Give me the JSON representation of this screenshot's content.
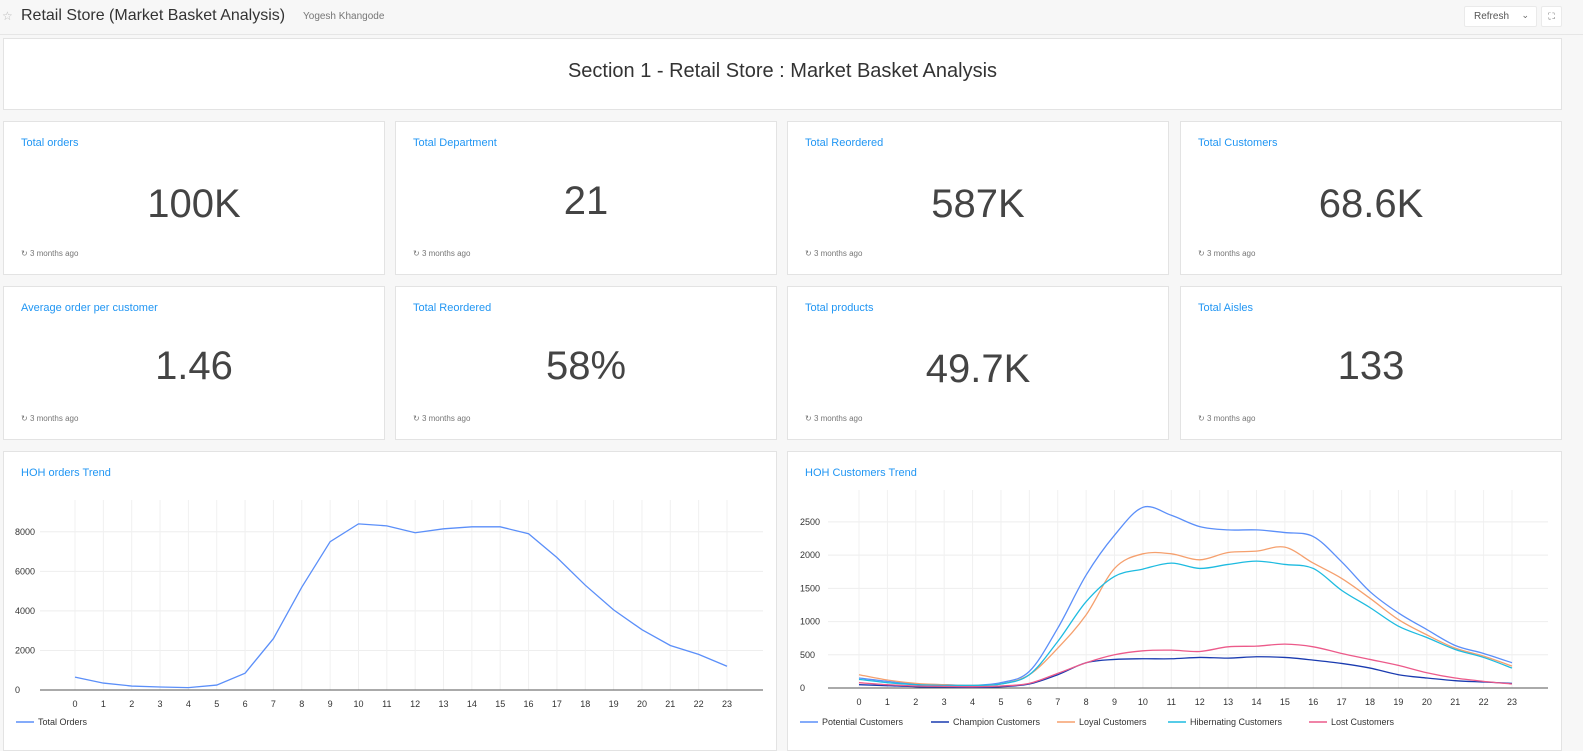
{
  "header": {
    "star_icon": "star-icon",
    "title": "Retail Store (Market Basket Analysis)",
    "author": "Yogesh Khangode",
    "refresh_label": "Refresh",
    "refresh_caret_icon": "chevron-down-icon",
    "fullscreen_icon": "fullscreen-icon"
  },
  "section": {
    "title": "Section 1 - Retail Store : Market Basket Analysis"
  },
  "counters": [
    {
      "title": "Total orders",
      "value": "100K",
      "updated": "3 months ago"
    },
    {
      "title": "Total Department",
      "value": "21",
      "updated": "3 months ago"
    },
    {
      "title": "Total Reordered",
      "value": "587K",
      "updated": "3 months ago"
    },
    {
      "title": "Total Customers",
      "value": "68.6K",
      "updated": "3 months ago"
    },
    {
      "title": "Average order per customer",
      "value": "1.46",
      "updated": "3 months ago"
    },
    {
      "title": "Total Reordered",
      "value": "58%",
      "updated": "3 months ago"
    },
    {
      "title": "Total products",
      "value": "49.7K",
      "updated": "3 months ago"
    },
    {
      "title": "Total Aisles",
      "value": "133",
      "updated": "3 months ago"
    }
  ],
  "colors": {
    "accent": "#2196f3",
    "potential": "#5b8ff9",
    "champion": "#1a3bb0",
    "loyal": "#f5a06e",
    "hibernating": "#1ebbe0",
    "lost": "#ec5a8a"
  },
  "chart_data": [
    {
      "type": "line",
      "title": "HOH orders Trend",
      "x": [
        0,
        1,
        2,
        3,
        4,
        5,
        6,
        7,
        8,
        9,
        10,
        11,
        12,
        13,
        14,
        15,
        16,
        17,
        18,
        19,
        20,
        21,
        22,
        23
      ],
      "xticks": [
        "0",
        "1",
        "2",
        "3",
        "4",
        "5",
        "6",
        "7",
        "8",
        "9",
        "10",
        "11",
        "12",
        "13",
        "14",
        "15",
        "16",
        "17",
        "18",
        "19",
        "20",
        "21",
        "22",
        "23"
      ],
      "yticks": [
        "0",
        "2000",
        "4000",
        "6000",
        "8000"
      ],
      "ylim": [
        0,
        9000
      ],
      "grid": true,
      "legend": "bottom-left",
      "series": [
        {
          "name": "Total Orders",
          "values": [
            650,
            350,
            200,
            150,
            120,
            250,
            850,
            2600,
            5200,
            7500,
            8400,
            8300,
            7950,
            8150,
            8250,
            8250,
            7900,
            6700,
            5300,
            4050,
            3050,
            2250,
            1800,
            1200
          ]
        }
      ]
    },
    {
      "type": "line",
      "title": "HOH Customers Trend",
      "x": [
        0,
        1,
        2,
        3,
        4,
        5,
        6,
        7,
        8,
        9,
        10,
        11,
        12,
        13,
        14,
        15,
        16,
        17,
        18,
        19,
        20,
        21,
        22,
        23
      ],
      "xticks": [
        "0",
        "1",
        "2",
        "3",
        "4",
        "5",
        "6",
        "7",
        "8",
        "9",
        "10",
        "11",
        "12",
        "13",
        "14",
        "15",
        "16",
        "17",
        "18",
        "19",
        "20",
        "21",
        "22",
        "23"
      ],
      "yticks": [
        "0",
        "500",
        "1000",
        "1500",
        "2000",
        "2500"
      ],
      "ylim": [
        0,
        2800
      ],
      "grid": true,
      "legend": "bottom",
      "series": [
        {
          "name": "Potential Customers",
          "values": [
            150,
            100,
            60,
            50,
            40,
            80,
            250,
            900,
            1700,
            2300,
            2720,
            2600,
            2430,
            2380,
            2380,
            2340,
            2280,
            1900,
            1450,
            1130,
            880,
            640,
            520,
            380
          ]
        },
        {
          "name": "Champion Customers",
          "values": [
            50,
            35,
            20,
            15,
            12,
            20,
            60,
            200,
            380,
            430,
            440,
            440,
            460,
            450,
            470,
            460,
            420,
            370,
            300,
            200,
            150,
            110,
            90,
            70
          ]
        },
        {
          "name": "Loyal Customers",
          "values": [
            200,
            120,
            70,
            50,
            40,
            60,
            200,
            600,
            1100,
            1800,
            2020,
            2020,
            1930,
            2040,
            2060,
            2120,
            1880,
            1650,
            1350,
            1030,
            800,
            600,
            480,
            330
          ]
        },
        {
          "name": "Hibernating Customers",
          "values": [
            130,
            80,
            50,
            40,
            40,
            60,
            200,
            700,
            1300,
            1680,
            1790,
            1880,
            1800,
            1860,
            1910,
            1860,
            1800,
            1470,
            1210,
            930,
            760,
            580,
            460,
            300
          ]
        },
        {
          "name": "Lost Customers",
          "values": [
            80,
            50,
            30,
            25,
            20,
            30,
            70,
            220,
            380,
            500,
            560,
            570,
            550,
            620,
            630,
            660,
            620,
            520,
            430,
            340,
            230,
            150,
            100,
            60
          ]
        }
      ]
    }
  ]
}
